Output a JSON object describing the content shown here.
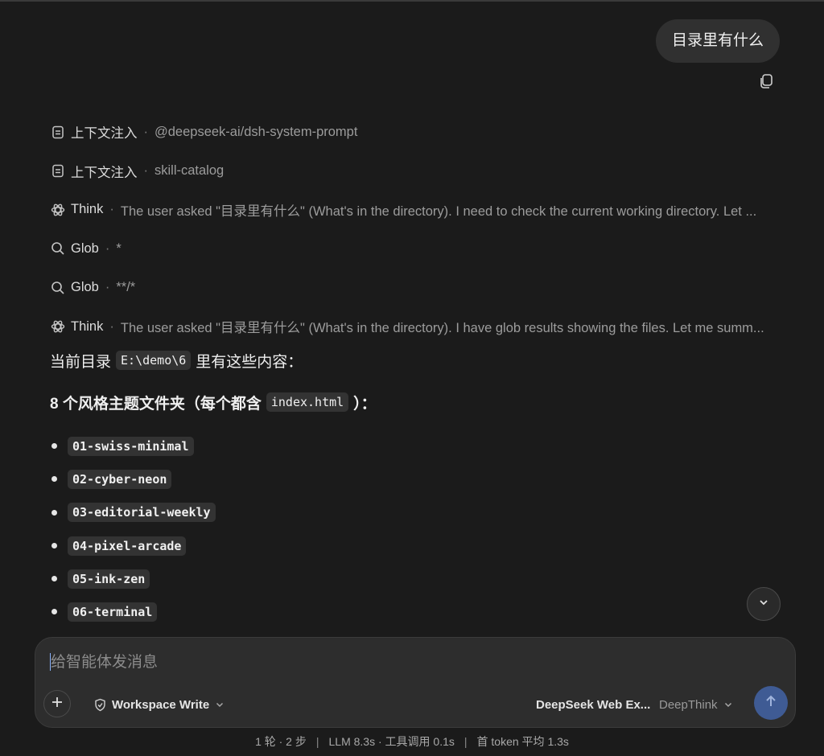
{
  "conversation": {
    "user_message": "目录里有什么",
    "steps": [
      {
        "icon": "document-icon",
        "kind": "上下文注入",
        "detail": "@deepseek-ai/dsh-system-prompt"
      },
      {
        "icon": "document-icon",
        "kind": "上下文注入",
        "detail": "skill-catalog"
      },
      {
        "icon": "brain-icon",
        "kind": "Think",
        "detail": "The user asked \"目录里有什么\" (What's in the directory). I need to check the current working directory. Let ..."
      },
      {
        "icon": "search-icon",
        "kind": "Glob",
        "detail": "*"
      },
      {
        "icon": "search-icon",
        "kind": "Glob",
        "detail": "**/*"
      },
      {
        "icon": "brain-icon",
        "kind": "Think",
        "detail": "The user asked \"目录里有什么\" (What's in the directory). I have glob results showing the files. Let me summ..."
      }
    ],
    "separator": "·",
    "answer": {
      "intro_prefix": "当前目录",
      "intro_path": "E:\\demo\\6",
      "intro_suffix": "里有这些内容：",
      "heading_prefix": "8 个风格主题文件夹（每个都含",
      "heading_code": "index.html",
      "heading_suffix": "）：",
      "folders": [
        "01-swiss-minimal",
        "02-cyber-neon",
        "03-editorial-weekly",
        "04-pixel-arcade",
        "05-ink-zen",
        "06-terminal"
      ]
    }
  },
  "composer": {
    "placeholder": "给智能体发消息",
    "mode_label": "Workspace Write",
    "model_label": "DeepSeek Web Ex...",
    "think_label": "DeepThink"
  },
  "status": {
    "turns": "1 轮 · 2 步",
    "timing": "LLM 8.3s · 工具调用 0.1s",
    "token": "首 token 平均 1.3s"
  },
  "colors": {
    "background": "#1b1b1b",
    "bubble": "#303030",
    "composer": "#2d2d2d",
    "send_button": "#3f5b94"
  }
}
